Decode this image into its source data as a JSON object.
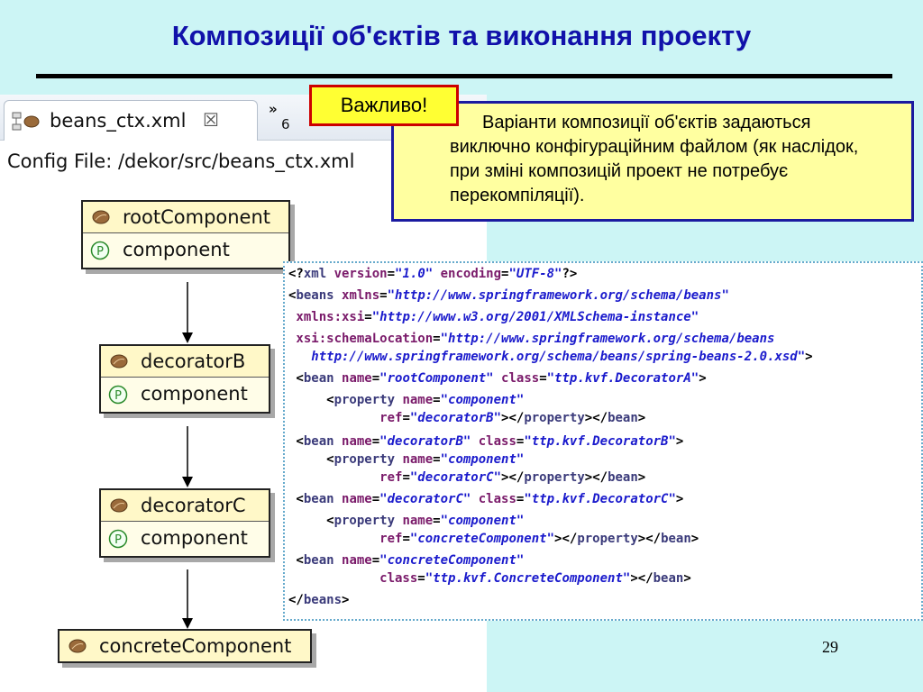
{
  "slide": {
    "title": "Композиції об'єктів та виконання проекту",
    "page_number": "29"
  },
  "editor": {
    "tab_label": "beans_ctx.xml",
    "tab_close": "☒",
    "overflow_label": "»",
    "overflow_count": "6",
    "config_file": "Config File: /dekor/src/beans_ctx.xml"
  },
  "beans": [
    {
      "name": "rootComponent",
      "property": "component"
    },
    {
      "name": "decoratorB",
      "property": "component"
    },
    {
      "name": "decoratorC",
      "property": "component"
    },
    {
      "name": "concreteComponent"
    }
  ],
  "callout": {
    "badge": "Важливо!",
    "text": "Варіанти композиції об'єктів задаються виключно конфігураційним файлом (як наслідок, при зміні композицій проект не потребує перекомпіляції)."
  },
  "code_lines": [
    [
      [
        "p",
        "<?"
      ],
      [
        "t",
        "xml "
      ],
      [
        "a",
        "version"
      ],
      [
        "p",
        "="
      ],
      [
        "v",
        "\"1.0\" "
      ],
      [
        "a",
        "encoding"
      ],
      [
        "p",
        "="
      ],
      [
        "v",
        "\"UTF-8\""
      ],
      [
        "p",
        "?>"
      ]
    ],
    [
      [
        "p",
        "<"
      ],
      [
        "t",
        "beans "
      ],
      [
        "a",
        "xmlns"
      ],
      [
        "p",
        "="
      ],
      [
        "v",
        "\"http://www.springframework.org/schema/beans\""
      ]
    ],
    [
      [
        "a",
        " xmlns:xsi"
      ],
      [
        "p",
        "="
      ],
      [
        "v",
        "\"http://www.w3.org/2001/XMLSchema-instance\""
      ]
    ],
    [
      [
        "a",
        " xsi:schemaLocation"
      ],
      [
        "p",
        "="
      ],
      [
        "v",
        "\"http://www.springframework.org/schema/beans"
      ]
    ],
    [
      [
        "v",
        "   http://www.springframework.org/schema/beans/spring-beans-2.0.xsd\""
      ],
      [
        "p",
        ">"
      ]
    ],
    [
      [
        "p",
        " <"
      ],
      [
        "t",
        "bean "
      ],
      [
        "a",
        "name"
      ],
      [
        "p",
        "="
      ],
      [
        "v",
        "\"rootComponent\" "
      ],
      [
        "a",
        "class"
      ],
      [
        "p",
        "="
      ],
      [
        "v",
        "\"ttp.kvf.DecoratorA\""
      ],
      [
        "p",
        ">"
      ]
    ],
    [
      [
        "p",
        "     <"
      ],
      [
        "t",
        "property "
      ],
      [
        "a",
        "name"
      ],
      [
        "p",
        "="
      ],
      [
        "v",
        "\"component\""
      ]
    ],
    [
      [
        "a",
        "            ref"
      ],
      [
        "p",
        "="
      ],
      [
        "v",
        "\"decoratorB\""
      ],
      [
        "p",
        "></"
      ],
      [
        "t",
        "property"
      ],
      [
        "p",
        "></"
      ],
      [
        "t",
        "bean"
      ],
      [
        "p",
        ">"
      ]
    ],
    [
      [
        "p",
        " <"
      ],
      [
        "t",
        "bean "
      ],
      [
        "a",
        "name"
      ],
      [
        "p",
        "="
      ],
      [
        "v",
        "\"decoratorB\" "
      ],
      [
        "a",
        "class"
      ],
      [
        "p",
        "="
      ],
      [
        "v",
        "\"ttp.kvf.DecoratorB\""
      ],
      [
        "p",
        ">"
      ]
    ],
    [
      [
        "p",
        "     <"
      ],
      [
        "t",
        "property "
      ],
      [
        "a",
        "name"
      ],
      [
        "p",
        "="
      ],
      [
        "v",
        "\"component\""
      ]
    ],
    [
      [
        "a",
        "            ref"
      ],
      [
        "p",
        "="
      ],
      [
        "v",
        "\"decoratorC\""
      ],
      [
        "p",
        "></"
      ],
      [
        "t",
        "property"
      ],
      [
        "p",
        "></"
      ],
      [
        "t",
        "bean"
      ],
      [
        "p",
        ">"
      ]
    ],
    [
      [
        "p",
        " <"
      ],
      [
        "t",
        "bean "
      ],
      [
        "a",
        "name"
      ],
      [
        "p",
        "="
      ],
      [
        "v",
        "\"decoratorC\" "
      ],
      [
        "a",
        "class"
      ],
      [
        "p",
        "="
      ],
      [
        "v",
        "\"ttp.kvf.DecoratorC\""
      ],
      [
        "p",
        ">"
      ]
    ],
    [
      [
        "p",
        "     <"
      ],
      [
        "t",
        "property "
      ],
      [
        "a",
        "name"
      ],
      [
        "p",
        "="
      ],
      [
        "v",
        "\"component\""
      ]
    ],
    [
      [
        "a",
        "            ref"
      ],
      [
        "p",
        "="
      ],
      [
        "v",
        "\"concreteComponent\""
      ],
      [
        "p",
        "></"
      ],
      [
        "t",
        "property"
      ],
      [
        "p",
        "></"
      ],
      [
        "t",
        "bean"
      ],
      [
        "p",
        ">"
      ]
    ],
    [
      [
        "p",
        " <"
      ],
      [
        "t",
        "bean "
      ],
      [
        "a",
        "name"
      ],
      [
        "p",
        "="
      ],
      [
        "v",
        "\"concreteComponent\""
      ]
    ],
    [
      [
        "a",
        "            class"
      ],
      [
        "p",
        "="
      ],
      [
        "v",
        "\"ttp.kvf.ConcreteComponent\""
      ],
      [
        "p",
        "></"
      ],
      [
        "t",
        "bean"
      ],
      [
        "p",
        ">"
      ]
    ],
    [
      [
        "p",
        "</"
      ],
      [
        "t",
        "beans"
      ],
      [
        "p",
        ">"
      ]
    ]
  ]
}
